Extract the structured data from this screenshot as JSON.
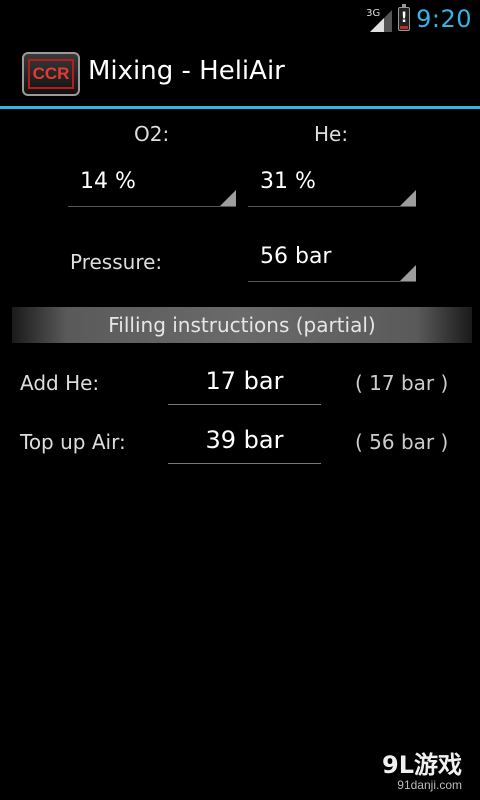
{
  "status_bar": {
    "network_type": "3G",
    "time": "9:20",
    "battery_level": 0.15,
    "battery_alert": "!"
  },
  "action_bar": {
    "app_icon_text": "CCR",
    "title": "Mixing - HeliAir"
  },
  "mix": {
    "o2_label": "O2:",
    "he_label": "He:",
    "o2_value": "14 %",
    "he_value": "31 %",
    "pressure_label": "Pressure:",
    "pressure_value": "56 bar"
  },
  "filling": {
    "header": "Filling instructions (partial)",
    "rows": [
      {
        "label": "Add He:",
        "value": "17 bar",
        "total": "( 17 bar )"
      },
      {
        "label": "Top up Air:",
        "value": "39 bar",
        "total": "( 56 bar )"
      }
    ]
  },
  "watermark": {
    "logo": "9L游戏",
    "url": "91danji.com"
  },
  "colors": {
    "accent": "#33b5e5",
    "battery_alert": "#c62828",
    "icon_red": "#e53935"
  }
}
